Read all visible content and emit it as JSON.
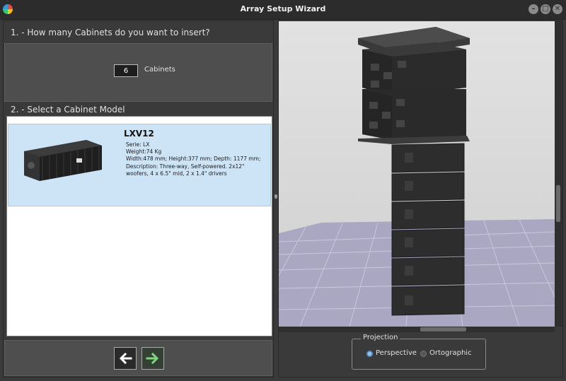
{
  "window": {
    "title": "Array Setup Wizard",
    "minimize_glyph": "–",
    "maximize_glyph": "□",
    "close_glyph": "✕"
  },
  "step1": {
    "label": "1. -  How many Cabinets do you want to insert?",
    "quantity": "6",
    "unit": "Cabinets"
  },
  "step2": {
    "label": "2. -  Select a Cabinet Model",
    "models": [
      {
        "name": "LXV12",
        "serie": "Serie: LX",
        "weight": "Weight:74 Kg",
        "dimensions": "Width:478 mm; Height:377 mm; Depth: 1177 mm;",
        "description_line1": "Description: Three-way, Self-powered. 2x12\"",
        "description_line2": "woofers, 4 x 6.5\" mid, 2 x 1.4\" drivers",
        "selected": true
      }
    ]
  },
  "navigation": {
    "back_icon": "arrow-left-icon",
    "next_icon": "arrow-right-icon"
  },
  "projection": {
    "title": "Projection",
    "options": [
      "Perspective",
      "Ortographic"
    ],
    "selected": "Perspective"
  },
  "colors": {
    "selection": "#cde4f7",
    "next_arrow": "#7ed67e",
    "grid_floor": "#a9a7c2",
    "viewport_bg": "#d9d9d9"
  }
}
